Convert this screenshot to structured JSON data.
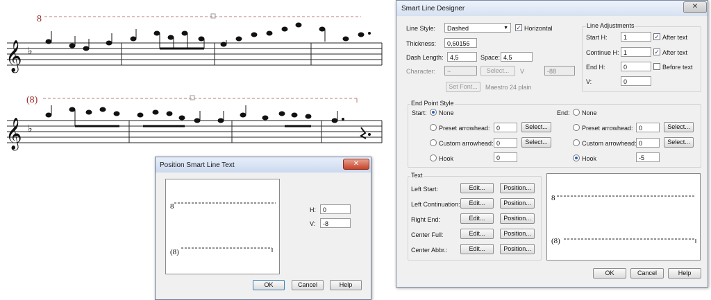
{
  "score": {
    "system1": {
      "octave_marking": "8"
    },
    "system2": {
      "octave_marking": "(8)"
    }
  },
  "position_dialog": {
    "title": "Position Smart Line Text",
    "preview_start": "8",
    "preview_cont": "(8)",
    "h_label": "H:",
    "h_value": "0",
    "v_label": "V:",
    "v_value": "-8",
    "ok": "OK",
    "cancel": "Cancel",
    "help": "Help"
  },
  "designer": {
    "title": "Smart Line Designer",
    "line_style_label": "Line Style:",
    "line_style_value": "Dashed",
    "horizontal_label": "Horizontal",
    "thickness_label": "Thickness:",
    "thickness_value": "0,60156",
    "dash_length_label": "Dash Length:",
    "dash_length_value": "4,5",
    "space_label": "Space:",
    "space_value": "4,5",
    "character_label": "Character:",
    "character_value": "~",
    "select_char": "Select...",
    "v_label": "V",
    "v_value": "-88",
    "set_font": "Set Font...",
    "font_name": "Maestro 24 plain",
    "line_adj": {
      "title": "Line Adjustments",
      "start_h_label": "Start H:",
      "start_h_value": "1",
      "after_text_1": "After text",
      "continue_h_label": "Continue H:",
      "continue_h_value": "1",
      "after_text_2": "After text",
      "end_h_label": "End H:",
      "end_h_value": "0",
      "before_text": "Before text",
      "v_label": "V:",
      "v_value": "0"
    },
    "end_point": {
      "title": "End Point Style",
      "start_label": "Start:",
      "end_label": "End:",
      "none": "None",
      "preset": "Preset arrowhead:",
      "custom": "Custom arrowhead:",
      "hook": "Hook",
      "select": "Select...",
      "start_preset_value": "0",
      "start_custom_value": "0",
      "start_hook_value": "0",
      "end_preset_value": "0",
      "end_custom_value": "0",
      "end_hook_value": "-5"
    },
    "text": {
      "title": "Text",
      "edit": "Edit...",
      "position": "Position...",
      "rows": [
        "Left Start:",
        "Left Continuation:",
        "Right End:",
        "Center Full:",
        "Center Abbr.:"
      ]
    },
    "preview_start": "8",
    "preview_cont": "(8)",
    "ok": "OK",
    "cancel": "Cancel",
    "help": "Help"
  }
}
